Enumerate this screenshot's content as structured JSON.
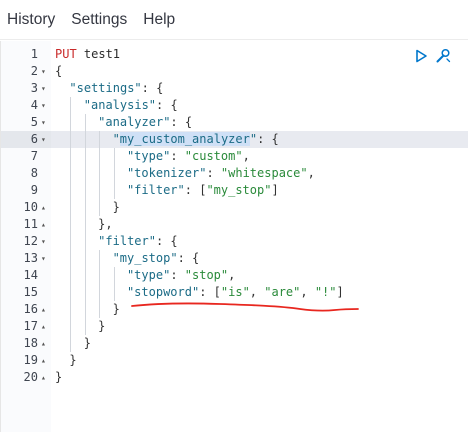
{
  "menu": {
    "items": [
      "History",
      "Settings",
      "Help"
    ]
  },
  "editor": {
    "active_line": 6,
    "highlighted_token": "my_custom_analyzer",
    "lines": [
      {
        "n": "1",
        "fold": "",
        "indent": 0,
        "tokens": [
          [
            "method",
            "PUT "
          ],
          [
            "url",
            "test1"
          ]
        ]
      },
      {
        "n": "2",
        "fold": "▾",
        "indent": 0,
        "tokens": [
          [
            "punc",
            "{"
          ]
        ]
      },
      {
        "n": "3",
        "fold": "▾",
        "indent": 1,
        "tokens": [
          [
            "key",
            "\"settings\""
          ],
          [
            "punc",
            ": {"
          ]
        ]
      },
      {
        "n": "4",
        "fold": "▾",
        "indent": 2,
        "tokens": [
          [
            "key",
            "\"analysis\""
          ],
          [
            "punc",
            ": {"
          ]
        ]
      },
      {
        "n": "5",
        "fold": "▾",
        "indent": 3,
        "tokens": [
          [
            "key",
            "\"analyzer\""
          ],
          [
            "punc",
            ": {"
          ]
        ]
      },
      {
        "n": "6",
        "fold": "▾",
        "indent": 4,
        "tokens": [
          [
            "key",
            "\""
          ],
          [
            "keyhl",
            "my_custom_analyzer"
          ],
          [
            "key",
            "\""
          ],
          [
            "punc",
            ": {"
          ]
        ]
      },
      {
        "n": "7",
        "fold": "",
        "indent": 5,
        "tokens": [
          [
            "key",
            "\"type\""
          ],
          [
            "punc",
            ": "
          ],
          [
            "str",
            "\"custom\""
          ],
          [
            "punc",
            ","
          ]
        ]
      },
      {
        "n": "8",
        "fold": "",
        "indent": 5,
        "tokens": [
          [
            "key",
            "\"tokenizer\""
          ],
          [
            "punc",
            ": "
          ],
          [
            "str",
            "\"whitespace\""
          ],
          [
            "punc",
            ","
          ]
        ]
      },
      {
        "n": "9",
        "fold": "",
        "indent": 5,
        "tokens": [
          [
            "key",
            "\"filter\""
          ],
          [
            "punc",
            ": ["
          ],
          [
            "str",
            "\"my_stop\""
          ],
          [
            "punc",
            "]"
          ]
        ]
      },
      {
        "n": "10",
        "fold": "▴",
        "indent": 4,
        "tokens": [
          [
            "punc",
            "}"
          ]
        ]
      },
      {
        "n": "11",
        "fold": "▴",
        "indent": 3,
        "tokens": [
          [
            "punc",
            "},"
          ]
        ]
      },
      {
        "n": "12",
        "fold": "▾",
        "indent": 3,
        "tokens": [
          [
            "key",
            "\"filter\""
          ],
          [
            "punc",
            ": {"
          ]
        ]
      },
      {
        "n": "13",
        "fold": "▾",
        "indent": 4,
        "tokens": [
          [
            "key",
            "\"my_stop\""
          ],
          [
            "punc",
            ": {"
          ]
        ]
      },
      {
        "n": "14",
        "fold": "",
        "indent": 5,
        "tokens": [
          [
            "key",
            "\"type\""
          ],
          [
            "punc",
            ": "
          ],
          [
            "str",
            "\"stop\""
          ],
          [
            "punc",
            ","
          ]
        ]
      },
      {
        "n": "15",
        "fold": "",
        "indent": 5,
        "tokens": [
          [
            "key",
            "\"stopword\""
          ],
          [
            "punc",
            ": ["
          ],
          [
            "str",
            "\"is\""
          ],
          [
            "punc",
            ", "
          ],
          [
            "str",
            "\"are\""
          ],
          [
            "punc",
            ", "
          ],
          [
            "str",
            "\"!\""
          ],
          [
            "punc",
            "]"
          ]
        ]
      },
      {
        "n": "16",
        "fold": "▴",
        "indent": 4,
        "tokens": [
          [
            "punc",
            "}"
          ]
        ]
      },
      {
        "n": "17",
        "fold": "▴",
        "indent": 3,
        "tokens": [
          [
            "punc",
            "}"
          ]
        ]
      },
      {
        "n": "18",
        "fold": "▴",
        "indent": 2,
        "tokens": [
          [
            "punc",
            "}"
          ]
        ]
      },
      {
        "n": "19",
        "fold": "▴",
        "indent": 1,
        "tokens": [
          [
            "punc",
            "}"
          ]
        ]
      },
      {
        "n": "20",
        "fold": "▴",
        "indent": 0,
        "tokens": [
          [
            "punc",
            "}"
          ]
        ]
      }
    ]
  },
  "actions": {
    "run_icon": "play-icon",
    "settings_icon": "wrench-icon",
    "colors": {
      "run": "#0077cc",
      "wrench": "#0077cc"
    }
  },
  "annotation": {
    "color": "#e8271f",
    "description": "red underline"
  }
}
